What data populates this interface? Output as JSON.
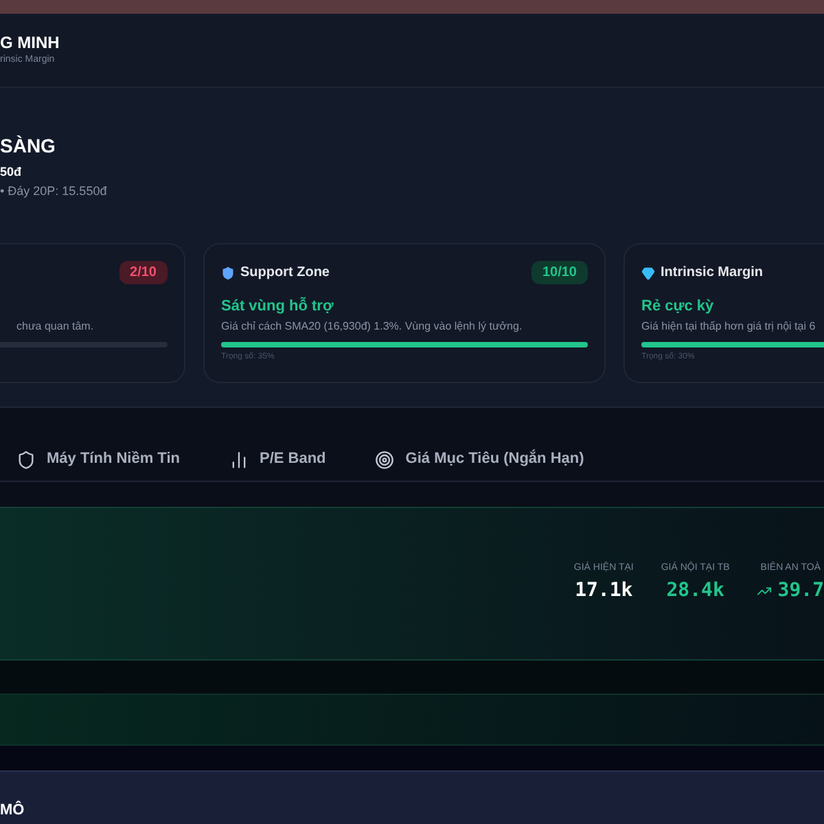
{
  "header": {
    "title": "G MINH",
    "subtitle": "rinsic Margin"
  },
  "verdict": {
    "title": "SÀNG",
    "price": "50đ",
    "detail": "• Đáy 20P: 15.550đ"
  },
  "cards": [
    {
      "kind": "partial",
      "score": "2/10",
      "text": "chưa quan tâm."
    },
    {
      "kind": "support",
      "title": "Support Zone",
      "score": "10/10",
      "headline": "Sát vùng hỗ trợ",
      "text": "Giá chỉ cách SMA20 (16,930đ) 1.3%. Vùng vào lệnh lý tưởng.",
      "level": 1,
      "weight": "Trọng số: 35%"
    },
    {
      "kind": "margin",
      "title": "Intrinsic Margin",
      "headline": "Rẻ cực kỳ",
      "text": "Giá hiện tại thấp hơn giá trị nội tại 6",
      "level": 1,
      "weight": "Trọng số: 30%"
    }
  ],
  "tabs": [
    {
      "label": "Máy Tính Niềm Tin",
      "selected": false
    },
    {
      "label": "P/E Band",
      "selected": false
    },
    {
      "label": "Giá Mục Tiêu (Ngắn Hạn)",
      "selected": false
    }
  ],
  "stats": [
    {
      "kind": "plain",
      "label": "GIÁ HIỆN TẠI",
      "value": "17.1k"
    },
    {
      "kind": "accent",
      "label": "GIÁ NỘI TẠI TB",
      "value": "28.4k"
    },
    {
      "kind": "trend",
      "label": "BIÊN AN TOÀ",
      "value": "39.7"
    }
  ],
  "footer": {
    "title": "MÔ"
  }
}
